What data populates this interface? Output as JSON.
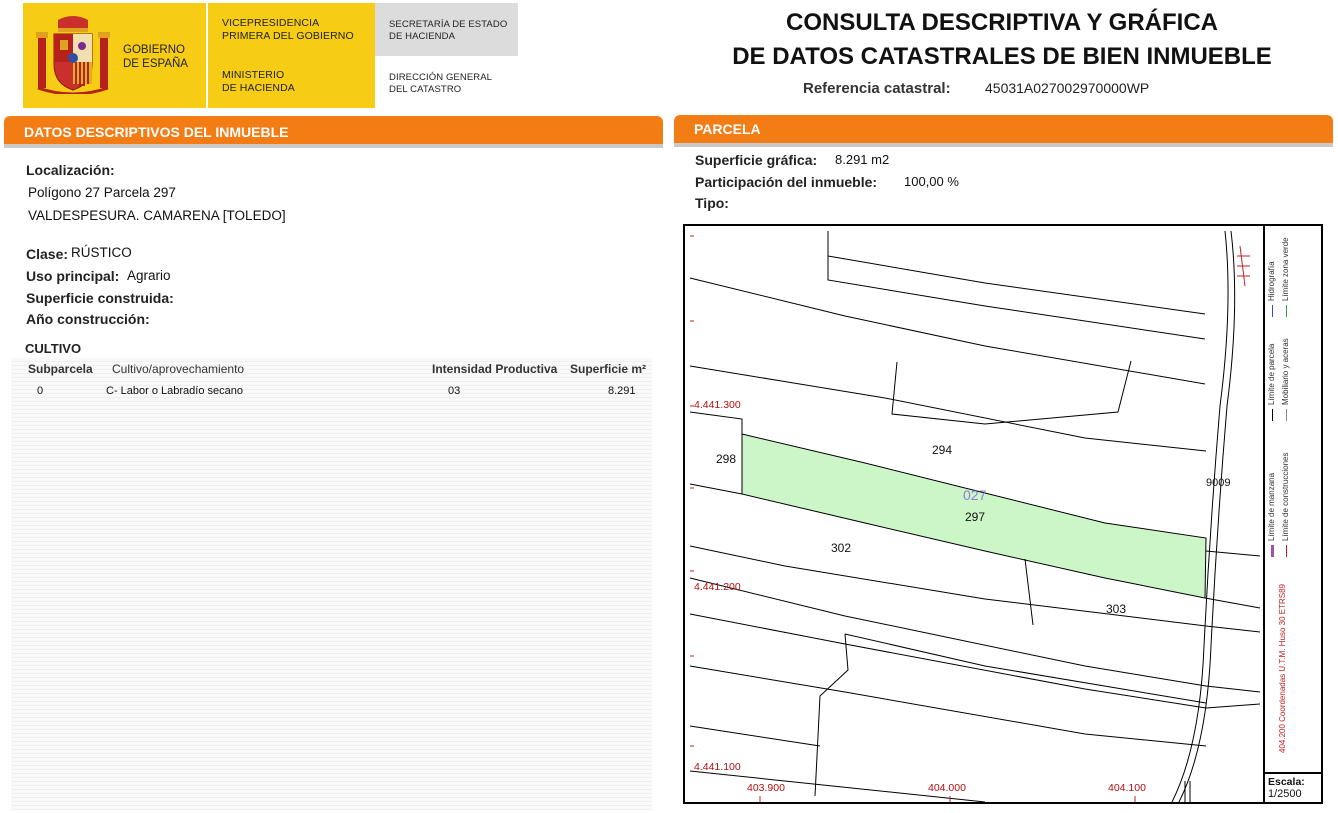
{
  "header": {
    "gov_name_line1": "GOBIERNO",
    "gov_name_line2": "DE ESPAÑA",
    "vice_line1": "VICEPRESIDENCIA",
    "vice_line2": "PRIMERA DEL GOBIERNO",
    "ministry_line1": "MINISTERIO",
    "ministry_line2": "DE HACIENDA",
    "secr_line1": "SECRETARÍA DE ESTADO",
    "secr_line2": "DE HACIENDA",
    "dir_line1": "DIRECCIÓN GENERAL",
    "dir_line2": "DEL CATASTRO",
    "title_line1": "CONSULTA DESCRIPTIVA Y GRÁFICA",
    "title_line2": "DE DATOS CATASTRALES DE BIEN INMUEBLE",
    "refcat_label": "Referencia catastral:",
    "refcat_value": "45031A027002970000WP"
  },
  "left": {
    "bar_title": "DATOS DESCRIPTIVOS DEL INMUEBLE",
    "localizacion_label": "Localización:",
    "loc_line1": "Polígono 27 Parcela 297",
    "loc_line2": "VALDESPESURA. CAMARENA [TOLEDO]",
    "clase_label": "Clase:",
    "clase_value": "RÚSTICO",
    "uso_label": "Uso principal:",
    "uso_value": "Agrario",
    "sup_label": "Superficie construida:",
    "anio_label": "Año construcción:",
    "cultivo_title": "CULTIVO",
    "table": {
      "headers": [
        "Subparcela",
        "Cultivo/aprovechamiento",
        "Intensidad Productiva",
        "Superficie m²"
      ],
      "rows": [
        [
          "0",
          "C- Labor o Labradío secano",
          "03",
          "8.291"
        ]
      ]
    }
  },
  "right": {
    "bar_title": "PARCELA",
    "sup_grafica_label": "Superficie gráfica:",
    "sup_grafica_value": "8.291 m2",
    "participacion_label": "Participación del inmueble:",
    "participacion_value": "100,00 %",
    "tipo_label": "Tipo:",
    "map": {
      "parcel_labels": [
        "294",
        "298",
        "297",
        "302",
        "303",
        "9009"
      ],
      "poligono_label": "027",
      "y_coords": [
        "4.441.300",
        "4.441.200",
        "4.441.100"
      ],
      "x_coords": [
        "403.900",
        "404.000",
        "404.100"
      ],
      "legend": [
        "Límite de manzana",
        "Límite de parcela",
        "Hidrografía",
        "Límite de construcciones",
        "Mobiliario y aceras",
        "Límite zona verde"
      ],
      "coord_system": "404.200 Coordenadas U.T.M. Huso 30 ETRS89",
      "scale_label": "Escala:",
      "scale_value": "1/2500"
    }
  },
  "colors": {
    "orange": "#f37c15",
    "gov_yellow": "#f6cc14",
    "parcel_fill": "#ccf5c8",
    "coord_red": "#b01010",
    "poligono_purple": "#8c7fd6"
  }
}
